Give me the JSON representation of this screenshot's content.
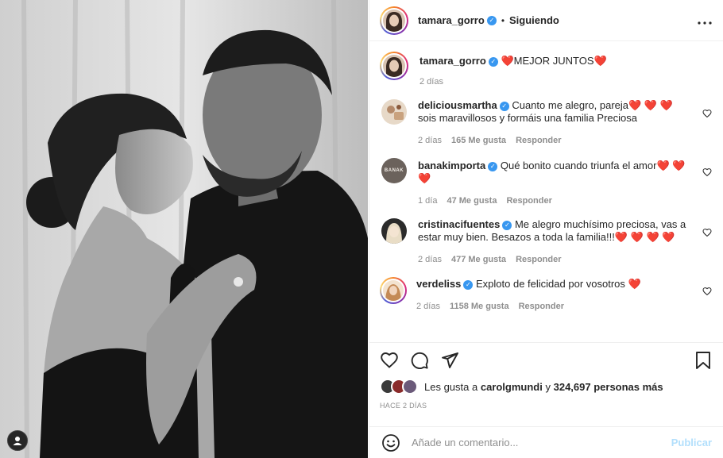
{
  "post": {
    "author": "tamara_gorro",
    "following_label": "Siguiendo",
    "separator": "•",
    "more_icon": "more-horizontal-icon"
  },
  "caption": {
    "author": "tamara_gorro",
    "text": "❤️MEJOR JUNTOS❤️",
    "time": "2 días"
  },
  "comments": [
    {
      "user": "deliciousmartha",
      "text": "Cuanto me alegro, pareja❤️ ❤️ ❤️ sois maravillosos y formáis una familia Preciosa",
      "time": "2 días",
      "likes": "165 Me gusta",
      "reply": "Responder"
    },
    {
      "user": "banakimporta",
      "avatar_text": "BANAK",
      "text": "Qué bonito cuando triunfa el amor❤️ ❤️ ❤️",
      "time": "1 día",
      "likes": "47 Me gusta",
      "reply": "Responder"
    },
    {
      "user": "cristinacifuentes",
      "text": "Me alegro muchísimo preciosa, vas a estar muy bien. Besazos a toda la familia!!!❤️ ❤️ ❤️ ❤️",
      "time": "2 días",
      "likes": "477 Me gusta",
      "reply": "Responder"
    },
    {
      "user": "verdeliss",
      "text": "Exploto de felicidad por vosotros ❤️",
      "time": "2 días",
      "likes": "1158 Me gusta",
      "reply": "Responder"
    }
  ],
  "likes": {
    "prefix": "Les gusta a",
    "user": "carolgmundi",
    "connector": "y",
    "count": "324,697 personas más"
  },
  "time_ago": "HACE 2 DÍAS",
  "composer": {
    "placeholder": "Añade un comentario...",
    "publish_label": "Publicar"
  },
  "colors": {
    "verified": "#3897f0",
    "heart_red": "#ed4956",
    "muted": "#8e8e8e",
    "publish_disabled": "#b2dffc"
  }
}
